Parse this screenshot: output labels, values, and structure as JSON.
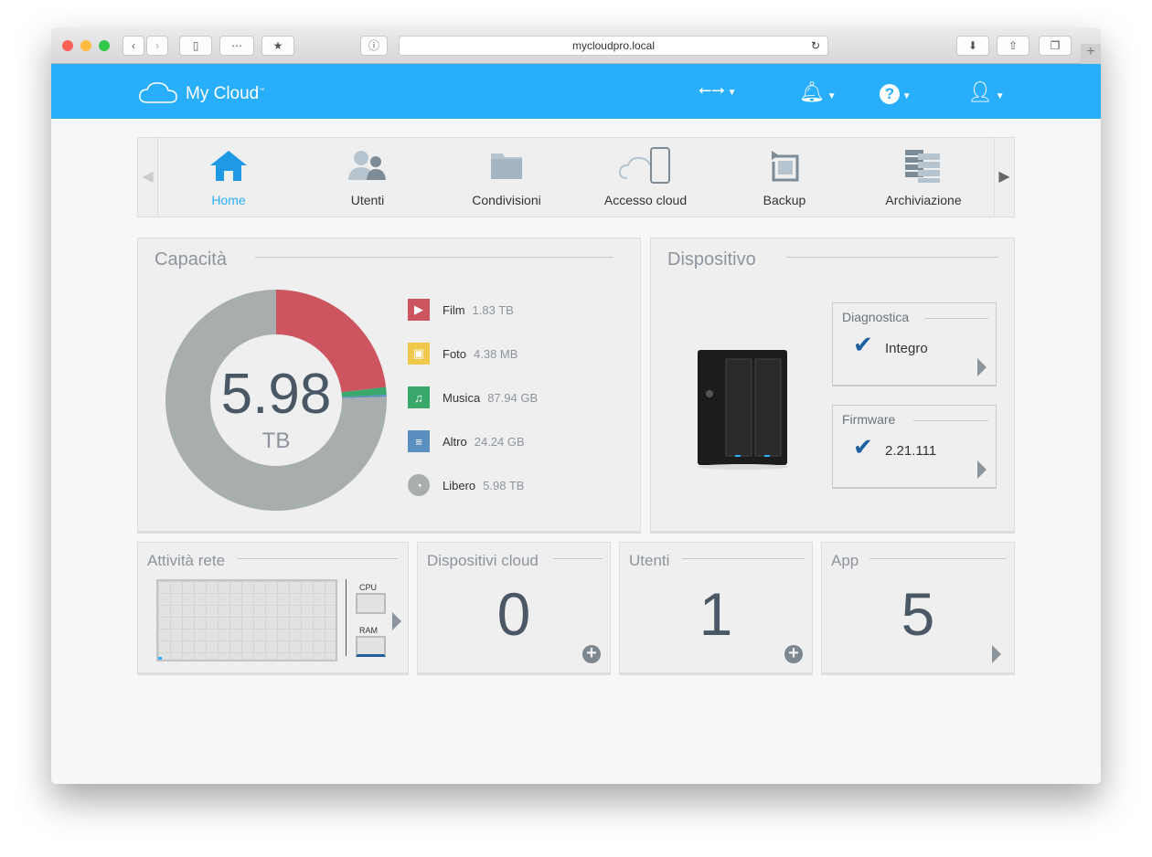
{
  "browser": {
    "url": "mycloudpro.local"
  },
  "header": {
    "logo": "My Cloud",
    "tm": "™"
  },
  "nav": {
    "items": [
      {
        "label": "Home",
        "active": true
      },
      {
        "label": "Utenti"
      },
      {
        "label": "Condivisioni"
      },
      {
        "label": "Accesso cloud"
      },
      {
        "label": "Backup"
      },
      {
        "label": "Archiviazione"
      }
    ]
  },
  "capacity": {
    "title": "Capacità",
    "total": "5.98",
    "unit": "TB",
    "legend": [
      {
        "label": "Film",
        "value": "1.83 TB",
        "amount_tb": 1.83,
        "color": "#cc5560",
        "icon": "film-icon"
      },
      {
        "label": "Foto",
        "value": "4.38 MB",
        "amount_tb": 4.4e-06,
        "color": "#f0c94a",
        "icon": "photo-icon"
      },
      {
        "label": "Musica",
        "value": "87.94 GB",
        "amount_tb": 0.088,
        "color": "#3aa86b",
        "icon": "music-icon"
      },
      {
        "label": "Altro",
        "value": "24.24 GB",
        "amount_tb": 0.024,
        "color": "#5a8fc0",
        "icon": "document-icon"
      },
      {
        "label": "Libero",
        "value": "5.98 TB",
        "amount_tb": 5.98,
        "color": "#a8adae",
        "icon": "free-space-icon"
      }
    ]
  },
  "device": {
    "title": "Dispositivo",
    "diagnostics": {
      "title": "Diagnostica",
      "status": "Integro"
    },
    "firmware": {
      "title": "Firmware",
      "version": "2.21.111"
    }
  },
  "network": {
    "title": "Attività rete",
    "cpu": "CPU",
    "ram": "RAM"
  },
  "cloud_devices": {
    "title": "Dispositivi cloud",
    "count": "0"
  },
  "users": {
    "title": "Utenti",
    "count": "1"
  },
  "apps": {
    "title": "App",
    "count": "5"
  }
}
